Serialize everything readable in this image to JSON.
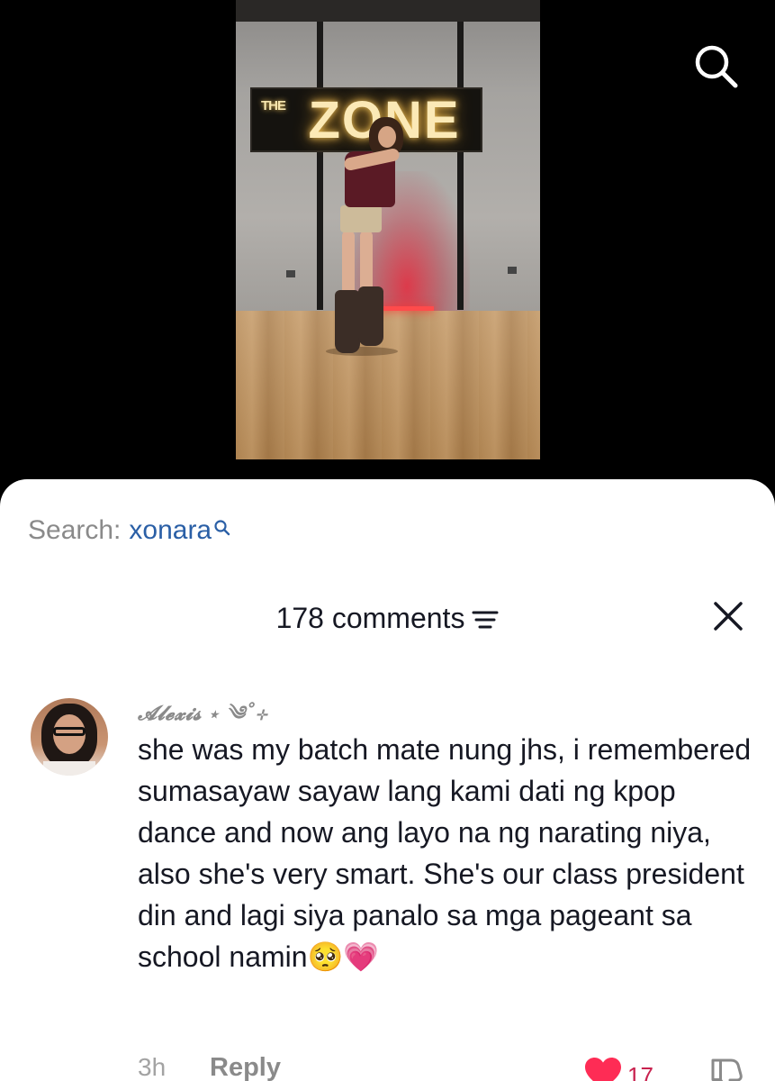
{
  "video": {
    "sign_small": "THE",
    "sign_big": "ZONE"
  },
  "top_bar": {
    "search_icon": "search-icon"
  },
  "search_suggestion": {
    "label": "Search:",
    "term": "xonara",
    "icon": "small-search-icon",
    "term_color": "#2a5fa6"
  },
  "comments": {
    "count_label": "178 comments",
    "sort_icon": "sort-filter-icon",
    "close_icon": "close-icon",
    "items": [
      {
        "username": "𝓐𝓵𝓮𝔁𝓲𝓼 ⋆ ༄˚⊹",
        "text": "she was my batch mate nung jhs, i remembered sumasayaw sayaw lang kami dati ng kpop dance and now ang layo na ng narating niya, also she's very smart. She's our class president din and lagi siya panalo sa mga pageant sa school namin",
        "emoji": "🥺💗",
        "time": "3h",
        "reply_label": "Reply",
        "likes": "17",
        "liked": true,
        "like_color": "#fe2c55"
      }
    ]
  }
}
